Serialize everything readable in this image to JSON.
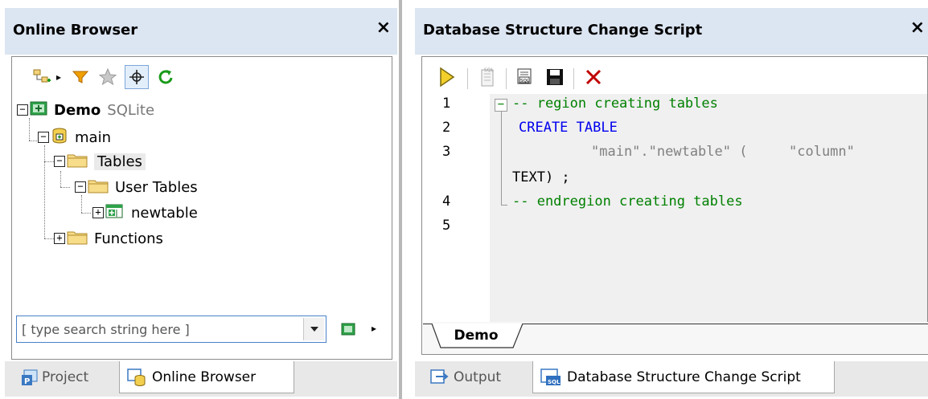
{
  "online_browser": {
    "title": "Online Browser",
    "close_label": "×",
    "toolbar": {
      "add_icon": "add-object-icon",
      "more_arrow": "▸",
      "filter_icon": "filter-icon",
      "favorites_icon": "star-icon",
      "locate_icon": "crosshair-icon",
      "refresh_icon": "refresh-icon"
    },
    "tree": {
      "root_label": "Demo",
      "root_type": "SQLite",
      "schema_label": "main",
      "tables_label": "Tables",
      "user_tables_label": "User Tables",
      "table_label": "newtable",
      "functions_label": "Functions"
    },
    "search": {
      "placeholder": "[ type search string here ]"
    },
    "tabs": {
      "project_label": "Project",
      "online_browser_label": "Online Browser"
    }
  },
  "script_window": {
    "title": "Database Structure Change Script",
    "close_label": "×",
    "line_numbers": [
      "1",
      "2",
      "3",
      "4",
      "5"
    ],
    "code": {
      "line1": "-- region creating tables",
      "line2": "CREATE TABLE",
      "line3_a": "\"main\".\"newtable\" (",
      "line3_b": "\"column\"",
      "line3_c": "TEXT) ;",
      "line4": "-- endregion creating tables",
      "fold_marker": "−"
    },
    "doc_tab_label": "Demo",
    "tabs": {
      "output_label": "Output",
      "script_label": "Database Structure Change Script"
    }
  },
  "colors": {
    "header_bg": "#dce5f2",
    "comment": "#008000",
    "keyword": "#0000ee",
    "string": "#808080",
    "execute": "#e8c200",
    "delete": "#c00000"
  }
}
